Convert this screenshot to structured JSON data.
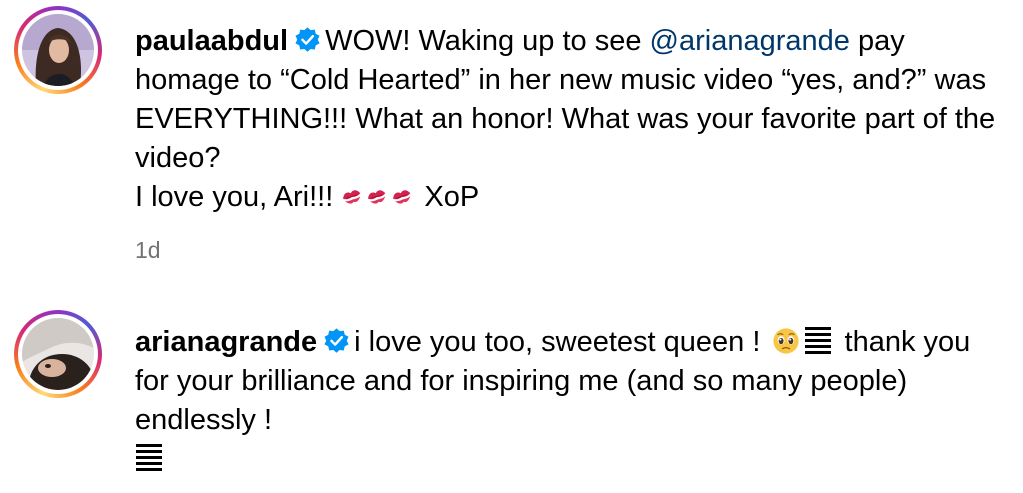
{
  "comments": [
    {
      "username": "paulaabdul",
      "verified": true,
      "text_1": "WOW! Waking up to see ",
      "mention": "@arianagrande",
      "text_2": " pay homage to “Cold Hearted” in her new music video “yes, and?” was EVERYTHING!!! What an honor! What was your favorite part of the video?",
      "text_3": "I love you, Ari!!! ",
      "emoji": "kiss-mark",
      "emoji_count": 3,
      "text_4": " XoP",
      "timestamp": "1d"
    },
    {
      "username": "arianagrande",
      "verified": true,
      "text_1": "i love you too, sweetest queen ! ",
      "emoji": "pleading-face",
      "text_2": " thank you for your brilliance and for inspiring me (and so many people) endlessly !"
    }
  ],
  "colors": {
    "mention": "#00376b",
    "verified_badge": "#0095f6",
    "timestamp": "#737373",
    "kiss": "#d4214d"
  }
}
